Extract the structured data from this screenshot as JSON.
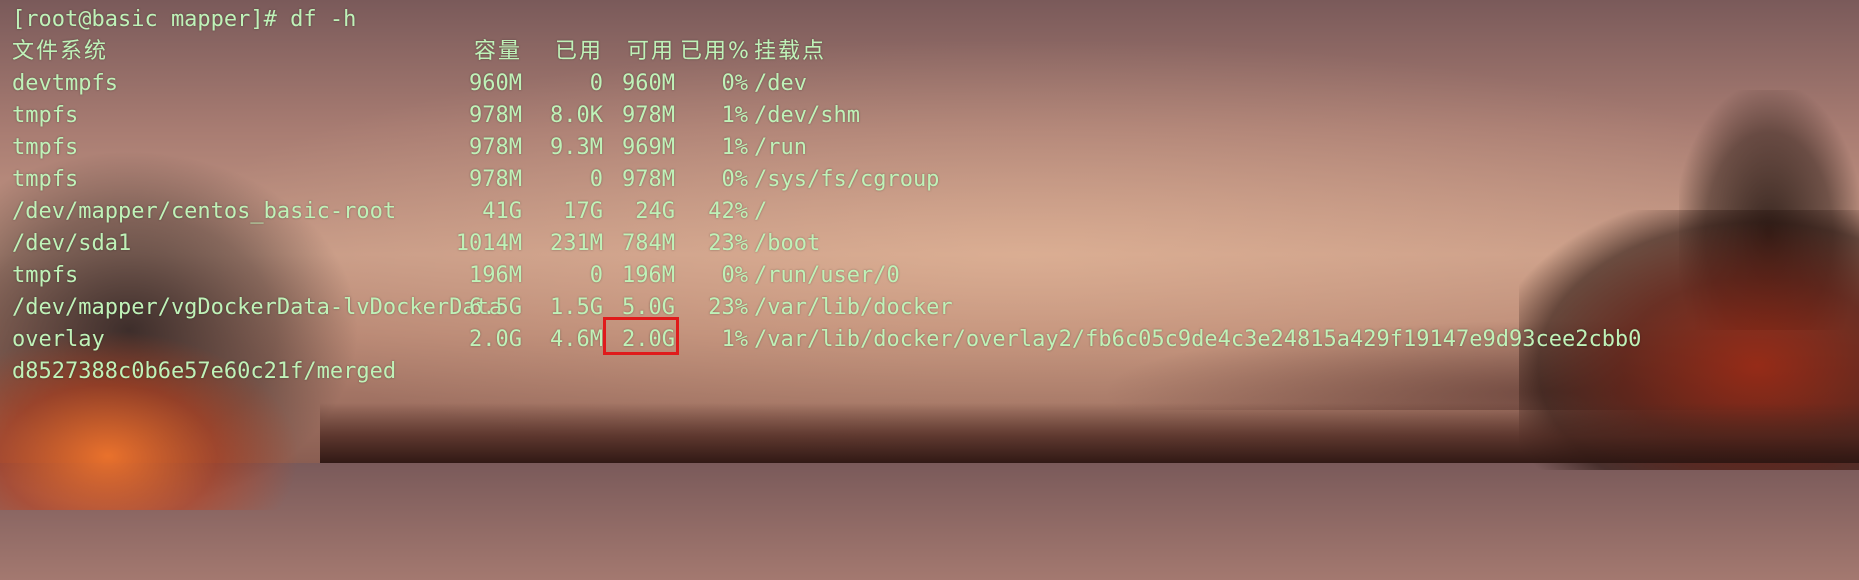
{
  "terminal": {
    "prompt": "[root@basic mapper]# df -h",
    "headers": {
      "filesystem": "文件系统",
      "size": "容量",
      "used": "已用",
      "avail": "可用",
      "use_pct": "已用%",
      "mounted_on": "挂载点"
    },
    "rows": [
      {
        "fs": "devtmpfs",
        "size": "960M",
        "used": "0",
        "avail": "960M",
        "pct": "0%",
        "mount": "/dev"
      },
      {
        "fs": "tmpfs",
        "size": "978M",
        "used": "8.0K",
        "avail": "978M",
        "pct": "1%",
        "mount": "/dev/shm"
      },
      {
        "fs": "tmpfs",
        "size": "978M",
        "used": "9.3M",
        "avail": "969M",
        "pct": "1%",
        "mount": "/run"
      },
      {
        "fs": "tmpfs",
        "size": "978M",
        "used": "0",
        "avail": "978M",
        "pct": "0%",
        "mount": "/sys/fs/cgroup"
      },
      {
        "fs": "/dev/mapper/centos_basic-root",
        "size": "41G",
        "used": "17G",
        "avail": "24G",
        "pct": "42%",
        "mount": "/"
      },
      {
        "fs": "/dev/sda1",
        "size": "1014M",
        "used": "231M",
        "avail": "784M",
        "pct": "23%",
        "mount": "/boot"
      },
      {
        "fs": "tmpfs",
        "size": "196M",
        "used": "0",
        "avail": "196M",
        "pct": "0%",
        "mount": "/run/user/0"
      },
      {
        "fs": "/dev/mapper/vgDockerData-lvDockerData",
        "size": "6.5G",
        "used": "1.5G",
        "avail": "5.0G",
        "pct": "23%",
        "mount": "/var/lib/docker"
      },
      {
        "fs": "overlay",
        "size": "2.0G",
        "used": "4.6M",
        "avail": "2.0G",
        "pct": "1%",
        "mount": "/var/lib/docker/overlay2/fb6c05c9de4c3e24815a429f19147e9d93cee2cbb0"
      }
    ],
    "wrap_line": "d8527388c0b6e57e60c21f/merged"
  },
  "colors": {
    "text": "#bff2b8",
    "highlight_box": "#e01b1b"
  }
}
